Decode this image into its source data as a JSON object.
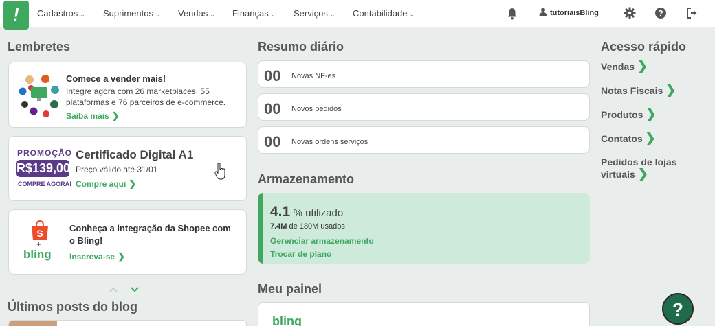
{
  "nav": {
    "logo": "!",
    "items": [
      {
        "label": "Cadastros"
      },
      {
        "label": "Suprimentos"
      },
      {
        "label": "Vendas"
      },
      {
        "label": "Finanças"
      },
      {
        "label": "Serviços"
      },
      {
        "label": "Contabilidade"
      }
    ],
    "username": "tutoriaisBling",
    "icons": [
      "bell-icon",
      "user-icon",
      "gear-icon",
      "help-icon",
      "logout-icon"
    ]
  },
  "reminders": {
    "title": "Lembretes",
    "card1": {
      "title": "Comece a vender mais!",
      "text": "Integre agora com 26 marketplaces, 55 plataformas e 76 parceiros de e-commerce.",
      "link": "Saiba mais"
    },
    "card2": {
      "promo": "PROMOÇÃO",
      "price": "R$139,00",
      "buy_now": "COMPRE AGORA!",
      "title": "Certificado Digital A1",
      "text": "Preço válido até 31/01",
      "link": "Compre aqui"
    },
    "card3": {
      "brand_plus": "+",
      "brand": "bling",
      "title": "Conheça a integração da Shopee com o Bling!",
      "link": "Inscreva-se"
    }
  },
  "blog": {
    "title": "Últimos posts do blog"
  },
  "daily": {
    "title": "Resumo diário",
    "counters": [
      {
        "value": "00",
        "label": "Novas NF-es"
      },
      {
        "value": "00",
        "label": "Novos pedidos"
      },
      {
        "value": "00",
        "label": "Novas ordens serviços"
      }
    ]
  },
  "storage": {
    "title": "Armazenamento",
    "percent": "4.1",
    "percent_suffix": "% utilizado",
    "used": "7.4M",
    "used_suffix": "de 180M usados",
    "manage_link": "Gerenciar armazenamento",
    "plan_link": "Trocar de plano"
  },
  "panel": {
    "title": "Meu painel",
    "brand": "bling"
  },
  "quick_access": {
    "title": "Acesso rápido",
    "links": [
      {
        "label": "Vendas"
      },
      {
        "label": "Notas Fiscais"
      },
      {
        "label": "Produtos"
      },
      {
        "label": "Contatos"
      },
      {
        "label_line1": "Pedidos de lojas",
        "label_line2": "virtuais"
      }
    ]
  },
  "fab": {
    "label": "?"
  },
  "colors": {
    "accent": "#3ea85f",
    "background": "#e9eeec",
    "promo_purple": "#5b3a86"
  }
}
